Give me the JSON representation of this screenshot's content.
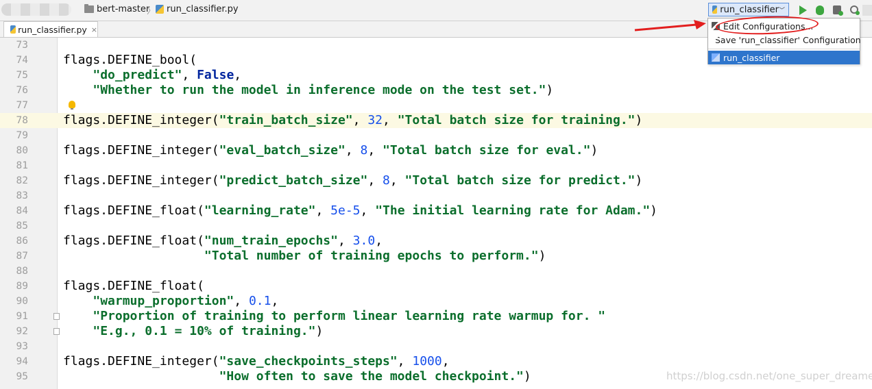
{
  "navbar": {
    "breadcrumbs": [
      "bert-master",
      "run_classifier.py"
    ],
    "run_config": "run_classifier"
  },
  "tabs": [
    {
      "label": "run_classifier.py",
      "close": "×"
    }
  ],
  "dropdown": {
    "items": [
      {
        "label": "Edit Configurations..."
      },
      {
        "label": "Save 'run_classifier' Configuration"
      },
      {
        "label": "run_classifier"
      }
    ]
  },
  "editor": {
    "lines": [
      {
        "n": "73",
        "tokens": []
      },
      {
        "n": "74",
        "tokens": [
          {
            "t": "plain",
            "v": "flags.DEFINE_bool("
          }
        ]
      },
      {
        "n": "75",
        "tokens": [
          {
            "t": "plain",
            "v": "    "
          },
          {
            "t": "str",
            "v": "\"do_predict\""
          },
          {
            "t": "plain",
            "v": ", "
          },
          {
            "t": "kw",
            "v": "False"
          },
          {
            "t": "plain",
            "v": ","
          }
        ]
      },
      {
        "n": "76",
        "tokens": [
          {
            "t": "plain",
            "v": "    "
          },
          {
            "t": "str",
            "v": "\"Whether to run the model in inference mode on the test set.\""
          },
          {
            "t": "plain",
            "v": ")"
          }
        ]
      },
      {
        "n": "77",
        "tokens": []
      },
      {
        "n": "78",
        "tokens": [
          {
            "t": "plain",
            "v": "flags.DEFINE_integer("
          },
          {
            "t": "str",
            "v": "\"train_batch_size\""
          },
          {
            "t": "plain",
            "v": ", "
          },
          {
            "t": "num",
            "v": "32"
          },
          {
            "t": "plain",
            "v": ", "
          },
          {
            "t": "str",
            "v": "\"Total batch size for training.\""
          },
          {
            "t": "plain",
            "v": ")"
          }
        ]
      },
      {
        "n": "79",
        "tokens": []
      },
      {
        "n": "80",
        "tokens": [
          {
            "t": "plain",
            "v": "flags.DEFINE_integer("
          },
          {
            "t": "str",
            "v": "\"eval_batch_size\""
          },
          {
            "t": "plain",
            "v": ", "
          },
          {
            "t": "num",
            "v": "8"
          },
          {
            "t": "plain",
            "v": ", "
          },
          {
            "t": "str",
            "v": "\"Total batch size for eval.\""
          },
          {
            "t": "plain",
            "v": ")"
          }
        ]
      },
      {
        "n": "81",
        "tokens": []
      },
      {
        "n": "82",
        "tokens": [
          {
            "t": "plain",
            "v": "flags.DEFINE_integer("
          },
          {
            "t": "str",
            "v": "\"predict_batch_size\""
          },
          {
            "t": "plain",
            "v": ", "
          },
          {
            "t": "num",
            "v": "8"
          },
          {
            "t": "plain",
            "v": ", "
          },
          {
            "t": "str",
            "v": "\"Total batch size for predict.\""
          },
          {
            "t": "plain",
            "v": ")"
          }
        ]
      },
      {
        "n": "83",
        "tokens": []
      },
      {
        "n": "84",
        "tokens": [
          {
            "t": "plain",
            "v": "flags.DEFINE_float("
          },
          {
            "t": "str",
            "v": "\"learning_rate\""
          },
          {
            "t": "plain",
            "v": ", "
          },
          {
            "t": "num",
            "v": "5e-5"
          },
          {
            "t": "plain",
            "v": ", "
          },
          {
            "t": "str",
            "v": "\"The initial learning rate for Adam.\""
          },
          {
            "t": "plain",
            "v": ")"
          }
        ]
      },
      {
        "n": "85",
        "tokens": []
      },
      {
        "n": "86",
        "tokens": [
          {
            "t": "plain",
            "v": "flags.DEFINE_float("
          },
          {
            "t": "str",
            "v": "\"num_train_epochs\""
          },
          {
            "t": "plain",
            "v": ", "
          },
          {
            "t": "num",
            "v": "3.0"
          },
          {
            "t": "plain",
            "v": ","
          }
        ]
      },
      {
        "n": "87",
        "tokens": [
          {
            "t": "plain",
            "v": "                   "
          },
          {
            "t": "str",
            "v": "\"Total number of training epochs to perform.\""
          },
          {
            "t": "plain",
            "v": ")"
          }
        ]
      },
      {
        "n": "88",
        "tokens": []
      },
      {
        "n": "89",
        "tokens": [
          {
            "t": "plain",
            "v": "flags.DEFINE_float("
          }
        ]
      },
      {
        "n": "90",
        "tokens": [
          {
            "t": "plain",
            "v": "    "
          },
          {
            "t": "str",
            "v": "\"warmup_proportion\""
          },
          {
            "t": "plain",
            "v": ", "
          },
          {
            "t": "num",
            "v": "0.1"
          },
          {
            "t": "plain",
            "v": ","
          }
        ]
      },
      {
        "n": "91",
        "tokens": [
          {
            "t": "plain",
            "v": "    "
          },
          {
            "t": "str",
            "v": "\"Proportion of training to perform linear learning rate warmup for. \""
          }
        ]
      },
      {
        "n": "92",
        "tokens": [
          {
            "t": "plain",
            "v": "    "
          },
          {
            "t": "str",
            "v": "\"E.g., 0.1 = 10% of training.\""
          },
          {
            "t": "plain",
            "v": ")"
          }
        ]
      },
      {
        "n": "93",
        "tokens": []
      },
      {
        "n": "94",
        "tokens": [
          {
            "t": "plain",
            "v": "flags.DEFINE_integer("
          },
          {
            "t": "str",
            "v": "\"save_checkpoints_steps\""
          },
          {
            "t": "plain",
            "v": ", "
          },
          {
            "t": "num",
            "v": "1000"
          },
          {
            "t": "plain",
            "v": ","
          }
        ]
      },
      {
        "n": "95",
        "tokens": [
          {
            "t": "plain",
            "v": "                     "
          },
          {
            "t": "str",
            "v": "\"How often to save the model checkpoint.\""
          },
          {
            "t": "plain",
            "v": ")"
          }
        ]
      }
    ]
  },
  "watermark": "https://blog.csdn.net/one_super_dreamer",
  "colors": {
    "string": "#0b6e2c",
    "number": "#1750eb",
    "keyword": "#00259e",
    "selection": "#2e75cc",
    "annotation": "#e21e1e"
  }
}
